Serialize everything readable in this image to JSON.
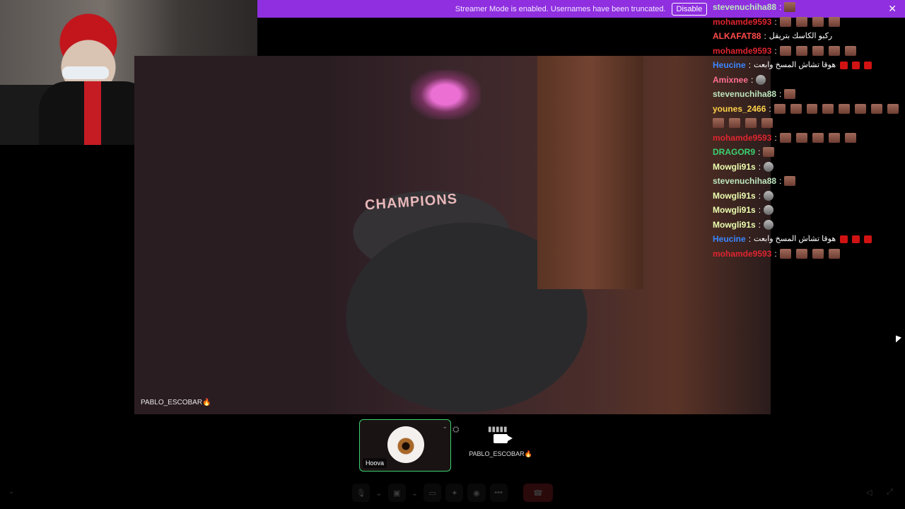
{
  "banner": {
    "text": "Streamer Mode is enabled. Usernames have been truncated.",
    "disable_label": "Disable",
    "close_glyph": "✕",
    "color": "#8f2fe0"
  },
  "stage": {
    "chair_text": "CHAMPIONS",
    "participant_name": "PABLO_ESCOBAR🔥"
  },
  "chat": [
    {
      "user": "stevenuchiha88",
      "color": "#bde6bd",
      "emotes": 1,
      "type": "brown"
    },
    {
      "user": "mohamde9593",
      "color": "#e0252f",
      "emotes": 4,
      "type": "brown"
    },
    {
      "user": "ALKAFAT88",
      "color": "#ff4b4b",
      "msg": "ركبو الكاسك بتريقل"
    },
    {
      "user": "mohamde9593",
      "color": "#e0252f",
      "emotes": 5,
      "type": "brown"
    },
    {
      "user": "Heucine",
      "color": "#3a86ff",
      "msg": "هوقا تشاش المسخ وابعت",
      "emotes": 3,
      "type": "red"
    },
    {
      "user": "Amixnee",
      "color": "#ff6f8f",
      "emotes": 1,
      "type": "grey"
    },
    {
      "user": "stevenuchiha88",
      "color": "#bde6bd",
      "emotes": 1,
      "type": "brown"
    },
    {
      "user": "younes_2466",
      "color": "#ffd24a",
      "emotes": 8,
      "type": "brown"
    },
    {
      "user": "",
      "color": "#ffffff",
      "emotes": 4,
      "type": "brown"
    },
    {
      "user": "mohamde9593",
      "color": "#e0252f",
      "emotes": 5,
      "type": "brown"
    },
    {
      "user": "DRAGOR9",
      "color": "#3bd16f",
      "emotes": 1,
      "type": "brown"
    },
    {
      "user": "Mowgli91s",
      "color": "#ecffb0",
      "emotes": 1,
      "type": "grey"
    },
    {
      "user": "stevenuchiha88",
      "color": "#bde6bd",
      "emotes": 1,
      "type": "brown"
    },
    {
      "user": "Mowgli91s",
      "color": "#ecffb0",
      "emotes": 1,
      "type": "grey"
    },
    {
      "user": "Mowgli91s",
      "color": "#ecffb0",
      "emotes": 1,
      "type": "grey"
    },
    {
      "user": "Mowgli91s",
      "color": "#ecffb0",
      "emotes": 1,
      "type": "grey"
    },
    {
      "user": "Heucine",
      "color": "#3a86ff",
      "msg": "هوقا تشاش المسخ وابعت",
      "emotes": 3,
      "type": "red"
    },
    {
      "user": "mohamde9593",
      "color": "#e0252f",
      "emotes": 4,
      "type": "brown"
    }
  ],
  "tiles": {
    "self_name": "Hoova",
    "other_name": "PABLO_ESCOBAR🔥",
    "active_border": "#3bd16f"
  },
  "controls": {
    "mic_icon": "🎙",
    "camera_icon": "▣",
    "screen_icon": "▭",
    "activities_icon": "✦",
    "more_icon": "•••",
    "hangup_icon": "☎"
  }
}
